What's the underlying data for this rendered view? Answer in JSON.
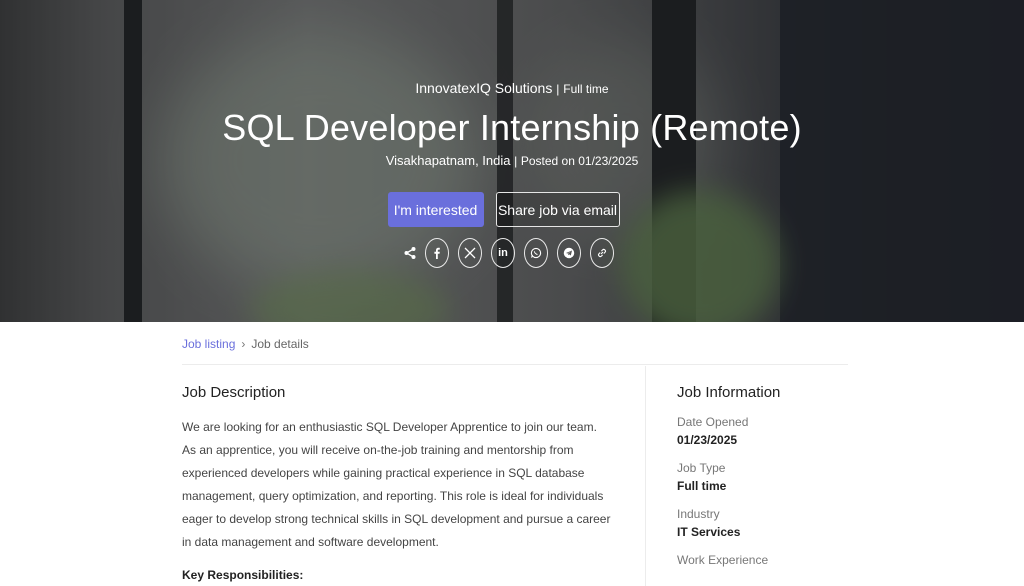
{
  "hero": {
    "company": "InnovatexIQ Solutions",
    "separator": "|",
    "employment_type": "Full time",
    "title": "SQL Developer Internship (Remote)",
    "location": "Visakhapatnam, India",
    "posted": "Posted on 01/23/2025",
    "primary_button": "I'm interested",
    "secondary_button": "Share job via email",
    "share_icons": [
      "share-icon",
      "facebook-icon",
      "x-icon",
      "linkedin-icon",
      "whatsapp-icon",
      "telegram-icon",
      "link-icon"
    ],
    "linkedin_text": "in"
  },
  "breadcrumb": {
    "link": "Job listing",
    "separator": "›",
    "current": "Job details"
  },
  "description": {
    "heading": "Job Description",
    "body": "We are looking for an enthusiastic SQL Developer Apprentice to join our team. As an apprentice, you will receive on-the-job training and mentorship from experienced developers while gaining practical experience in SQL database management, query optimization, and reporting. This role is ideal for individuals eager to develop strong technical skills in SQL development and pursue a career in data management and software development.",
    "responsibilities_heading": "Key Responsibilities:"
  },
  "info": {
    "heading": "Job Information",
    "items": [
      {
        "label": "Date Opened",
        "value": "01/23/2025"
      },
      {
        "label": "Job Type",
        "value": "Full time"
      },
      {
        "label": "Industry",
        "value": "IT Services"
      },
      {
        "label": "Work Experience",
        "value": ""
      }
    ]
  },
  "colors": {
    "accent": "#6a6fdc",
    "hero_dark": "#1e1f21"
  }
}
